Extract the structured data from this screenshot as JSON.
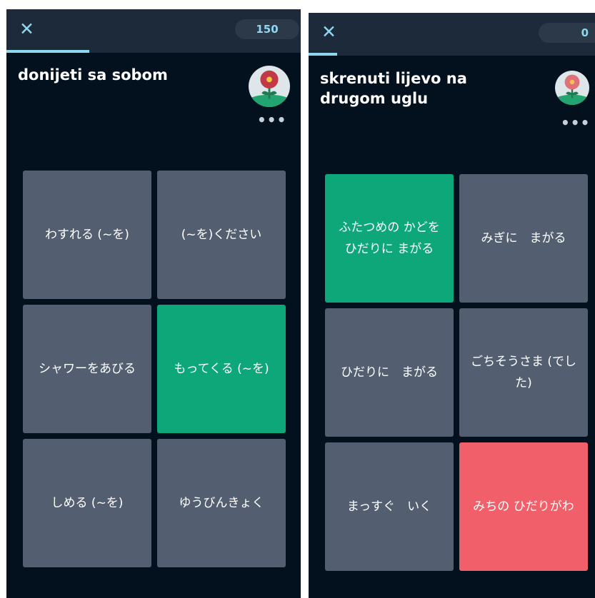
{
  "screens": [
    {
      "score": "150",
      "progress": 0.28,
      "prompt": "donijeti sa sobom",
      "options": [
        {
          "label": "わすれる (~を)",
          "state": "default"
        },
        {
          "label": "(~を)ください",
          "state": "default"
        },
        {
          "label": "シャワーをあびる",
          "state": "default"
        },
        {
          "label": "もってくる (~を)",
          "state": "correct"
        },
        {
          "label": "しめる (~を)",
          "state": "default"
        },
        {
          "label": "ゆうびんきょく",
          "state": "default"
        }
      ]
    },
    {
      "score": "0",
      "progress": 0.1,
      "prompt": "skrenuti lijevo na drugom uglu",
      "options": [
        {
          "label": "ふたつめの かどを ひだりに まがる",
          "state": "correct"
        },
        {
          "label": "みぎに　まがる",
          "state": "default"
        },
        {
          "label": "ひだりに　まがる",
          "state": "default"
        },
        {
          "label": "ごちそうさま (でした)",
          "state": "default"
        },
        {
          "label": "まっすぐ　いく",
          "state": "default"
        },
        {
          "label": "みちの ひだりがわ",
          "state": "wrong"
        }
      ]
    }
  ],
  "icons": {
    "close": "close-icon",
    "avatar": "flower-avatar-icon",
    "more": "more-options-icon"
  },
  "colors": {
    "background": "#03101d",
    "topbar": "#1c2a3a",
    "accent": "#8fd7ee",
    "tile": "#535f71",
    "correct": "#0ea77a",
    "wrong": "#f1606a"
  }
}
